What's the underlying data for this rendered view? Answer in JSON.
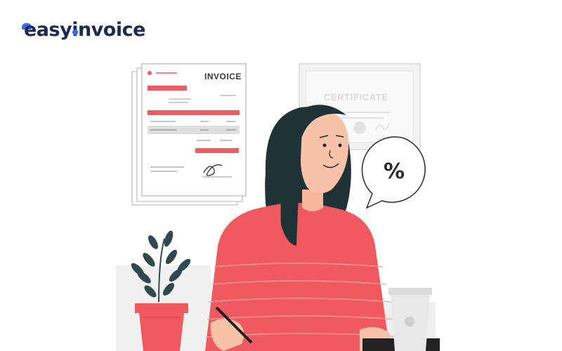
{
  "brand": {
    "logo_text_a": "easy",
    "logo_text_b": "invoice",
    "logo_color": "#1f2a52",
    "accent_color": "#2f6bff"
  },
  "illustration": {
    "invoice_label": "INVOICE",
    "certificate_label": "CERTIFICATE",
    "speech_bubble_text": "%",
    "primary_color": "#f05a5e",
    "hair_color": "#1f3237",
    "plant_color": "#2f4a4f"
  }
}
